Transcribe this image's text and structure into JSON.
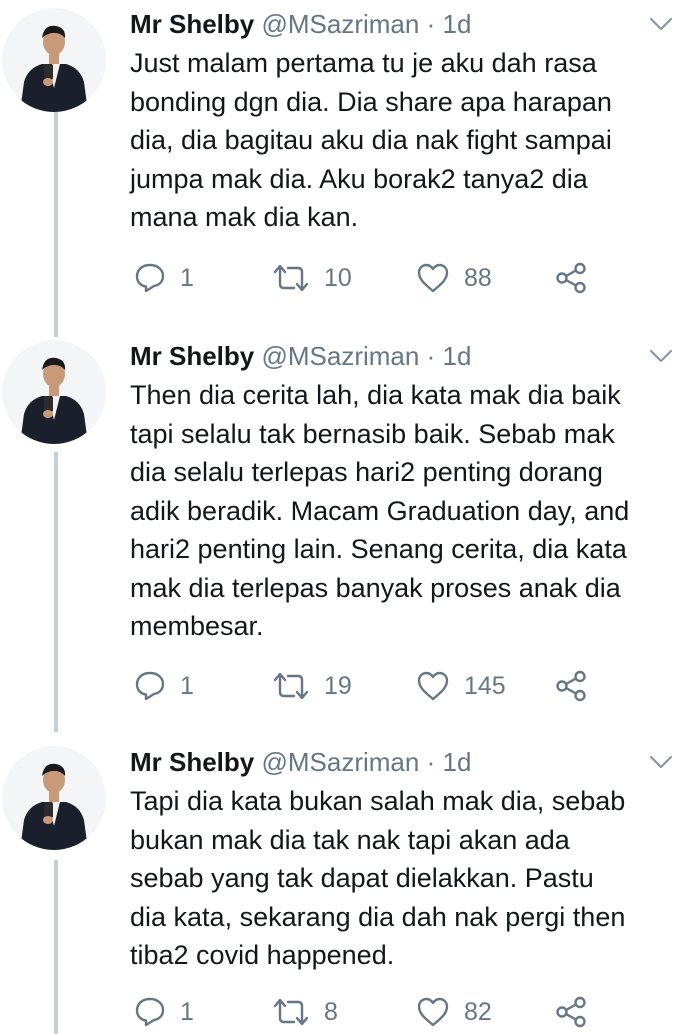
{
  "tweets": [
    {
      "name": "Mr Shelby",
      "handle": "@MSazriman",
      "separator": "·",
      "time": "1d",
      "text": "Just malam pertama tu je aku dah rasa\nbonding dgn dia. Dia share apa harapan\ndia, dia bagitau aku dia nak fight sampai\njumpa mak dia. Aku borak2 tanya2 dia\nmana mak dia kan.",
      "replies": "1",
      "retweets": "10",
      "likes": "88"
    },
    {
      "name": "Mr Shelby",
      "handle": "@MSazriman",
      "separator": "·",
      "time": "1d",
      "text": "Then dia cerita lah, dia kata mak dia baik\ntapi selalu tak bernasib baik. Sebab mak\ndia selalu terlepas hari2 penting dorang\nadik beradik. Macam Graduation day, and\nhari2 penting lain. Senang cerita, dia kata\nmak dia terlepas banyak proses anak dia\nmembesar.",
      "replies": "1",
      "retweets": "19",
      "likes": "145"
    },
    {
      "name": "Mr Shelby",
      "handle": "@MSazriman",
      "separator": "·",
      "time": "1d",
      "text": "Tapi dia kata bukan salah mak dia, sebab\nbukan mak dia tak nak tapi akan ada\nsebab yang tak dapat dielakkan. Pastu\ndia kata, sekarang dia dah nak pergi then\ntiba2 covid happened.",
      "replies": "1",
      "retweets": "8",
      "likes": "82"
    }
  ],
  "colors": {
    "text": "#14171a",
    "secondary": "#657786",
    "thread_line": "#c4cfd6",
    "background": "#ffffff"
  },
  "icons": [
    "reply-icon",
    "retweet-icon",
    "like-icon",
    "share-icon",
    "chevron-down-icon"
  ]
}
